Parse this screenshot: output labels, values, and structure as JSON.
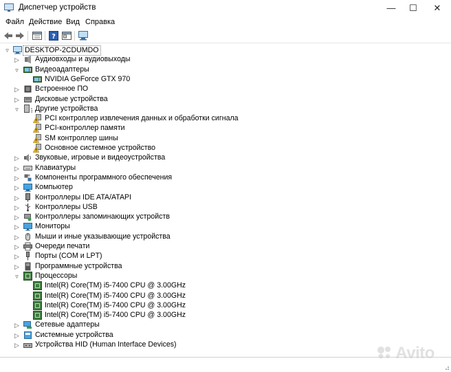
{
  "window": {
    "title": "Диспетчер устройств",
    "minimize": "—",
    "maximize": "☐",
    "close": "✕"
  },
  "menu": [
    "Файл",
    "Действие",
    "Вид",
    "Справка"
  ],
  "tree": {
    "root": "DESKTOP-2CDUMDO",
    "nodes": [
      {
        "label": "Аудиовходы и аудиовыходы",
        "icon": "audio-io-icon",
        "state": "collapsed",
        "indent": 1
      },
      {
        "label": "Видеоадаптеры",
        "icon": "display-adapter-icon",
        "state": "expanded",
        "indent": 1
      },
      {
        "label": "NVIDIA GeForce GTX 970",
        "icon": "display-adapter-icon",
        "state": "leaf",
        "indent": 2
      },
      {
        "label": "Встроенное ПО",
        "icon": "firmware-icon",
        "state": "collapsed",
        "indent": 1
      },
      {
        "label": "Дисковые устройства",
        "icon": "disk-drive-icon",
        "state": "collapsed",
        "indent": 1
      },
      {
        "label": "Другие устройства",
        "icon": "other-devices-icon",
        "state": "expanded",
        "indent": 1
      },
      {
        "label": "PCI контроллер извлечения данных и обработки сигнала",
        "icon": "warning-device-icon",
        "state": "leaf",
        "indent": 2
      },
      {
        "label": "PCI-контроллер памяти",
        "icon": "warning-device-icon",
        "state": "leaf",
        "indent": 2
      },
      {
        "label": "SM контроллер шины",
        "icon": "warning-device-icon",
        "state": "leaf",
        "indent": 2
      },
      {
        "label": "Основное системное устройство",
        "icon": "warning-device-icon",
        "state": "leaf",
        "indent": 2
      },
      {
        "label": "Звуковые, игровые и видеоустройства",
        "icon": "sound-icon",
        "state": "collapsed",
        "indent": 1
      },
      {
        "label": "Клавиатуры",
        "icon": "keyboard-icon",
        "state": "collapsed",
        "indent": 1
      },
      {
        "label": "Компоненты программного обеспечения",
        "icon": "software-component-icon",
        "state": "collapsed",
        "indent": 1
      },
      {
        "label": "Компьютер",
        "icon": "computer-icon",
        "state": "collapsed",
        "indent": 1
      },
      {
        "label": "Контроллеры IDE ATA/ATAPI",
        "icon": "ide-controller-icon",
        "state": "collapsed",
        "indent": 1
      },
      {
        "label": "Контроллеры USB",
        "icon": "usb-icon",
        "state": "collapsed",
        "indent": 1
      },
      {
        "label": "Контроллеры запоминающих устройств",
        "icon": "storage-controller-icon",
        "state": "collapsed",
        "indent": 1
      },
      {
        "label": "Мониторы",
        "icon": "monitor-icon",
        "state": "collapsed",
        "indent": 1
      },
      {
        "label": "Мыши и иные указывающие устройства",
        "icon": "mouse-icon",
        "state": "collapsed",
        "indent": 1
      },
      {
        "label": "Очереди печати",
        "icon": "printer-icon",
        "state": "collapsed",
        "indent": 1
      },
      {
        "label": "Порты (COM и LPT)",
        "icon": "port-icon",
        "state": "collapsed",
        "indent": 1
      },
      {
        "label": "Программные устройства",
        "icon": "software-device-icon",
        "state": "collapsed",
        "indent": 1
      },
      {
        "label": "Процессоры",
        "icon": "processor-icon",
        "state": "expanded",
        "indent": 1
      },
      {
        "label": "Intel(R) Core(TM) i5-7400 CPU @ 3.00GHz",
        "icon": "processor-icon",
        "state": "leaf",
        "indent": 2
      },
      {
        "label": "Intel(R) Core(TM) i5-7400 CPU @ 3.00GHz",
        "icon": "processor-icon",
        "state": "leaf",
        "indent": 2
      },
      {
        "label": "Intel(R) Core(TM) i5-7400 CPU @ 3.00GHz",
        "icon": "processor-icon",
        "state": "leaf",
        "indent": 2
      },
      {
        "label": "Intel(R) Core(TM) i5-7400 CPU @ 3.00GHz",
        "icon": "processor-icon",
        "state": "leaf",
        "indent": 2
      },
      {
        "label": "Сетевые адаптеры",
        "icon": "network-adapter-icon",
        "state": "collapsed",
        "indent": 1
      },
      {
        "label": "Системные устройства",
        "icon": "system-device-icon",
        "state": "collapsed",
        "indent": 1
      },
      {
        "label": "Устройства HID (Human Interface Devices)",
        "icon": "hid-icon",
        "state": "collapsed",
        "indent": 1
      }
    ]
  },
  "watermark": "Avito"
}
